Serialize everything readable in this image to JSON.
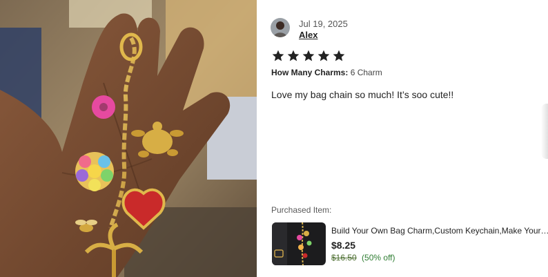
{
  "review": {
    "date": "Jul 19, 2025",
    "author": "Alex",
    "rating": 5,
    "rating_max": 5,
    "variation_key": "How Many Charms:",
    "variation_value": "6 Charm",
    "text": "Love my bag chain so much! It’s soo cute!!"
  },
  "purchased": {
    "label": "Purchased Item:",
    "title": "Build Your Own Bag Charm,Custom Keychain,Make Your O...",
    "price": "$8.25",
    "original_price": "$16.50",
    "discount": "(50% off)"
  },
  "colors": {
    "star": "#222222",
    "discount_green": "#2e7d32",
    "original_price": "#4b6d2f"
  }
}
